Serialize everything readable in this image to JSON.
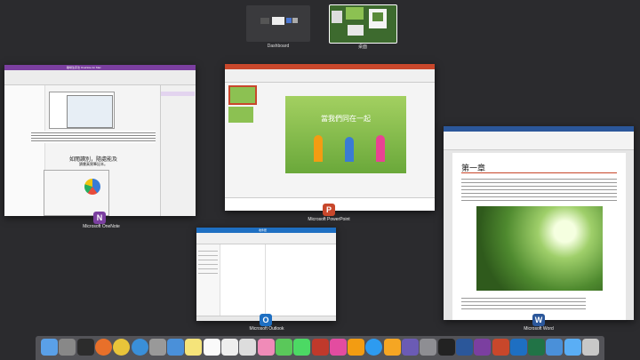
{
  "spaces": [
    {
      "label": "Dashboard"
    },
    {
      "label": "桌面"
    }
  ],
  "windows": {
    "onenote": {
      "label": "Microsoft OneNote",
      "title": "職場生存法 OneNote for Mac",
      "heading": "如閱讀別，隨處能及",
      "subheading": "讀書真實筆記本。"
    },
    "powerpoint": {
      "label": "Microsoft PowerPoint",
      "slide_title": "當我們同在一起"
    },
    "word": {
      "label": "Microsoft Word",
      "chapter": "第一章"
    },
    "outlook": {
      "label": "Microsoft Outlook",
      "title": "收件匣"
    }
  },
  "colors": {
    "desktop": "#2b2b2e",
    "onenote": "#7b3fa0",
    "powerpoint": "#c8472b",
    "word": "#2b579a",
    "outlook": "#1e6fc2"
  },
  "dock_icons": [
    "finder-icon",
    "launchpad-icon",
    "mission-control-icon",
    "firefox-icon",
    "chrome-icon",
    "safari-icon",
    "rocket-icon",
    "mail-icon",
    "notes-icon",
    "calendar-icon",
    "reminders-icon",
    "textedit-icon",
    "photos-icon",
    "messages-icon",
    "facetime-icon",
    "photo-booth-icon",
    "itunes-icon",
    "ibooks-icon",
    "app-store-icon",
    "pages-icon",
    "instruments-icon",
    "system-preferences-icon",
    "terminal-icon",
    "word-icon",
    "onenote-icon",
    "powerpoint-icon",
    "outlook-icon",
    "excel-icon",
    "downloads-folder-icon",
    "documents-icon",
    "trash-icon"
  ]
}
